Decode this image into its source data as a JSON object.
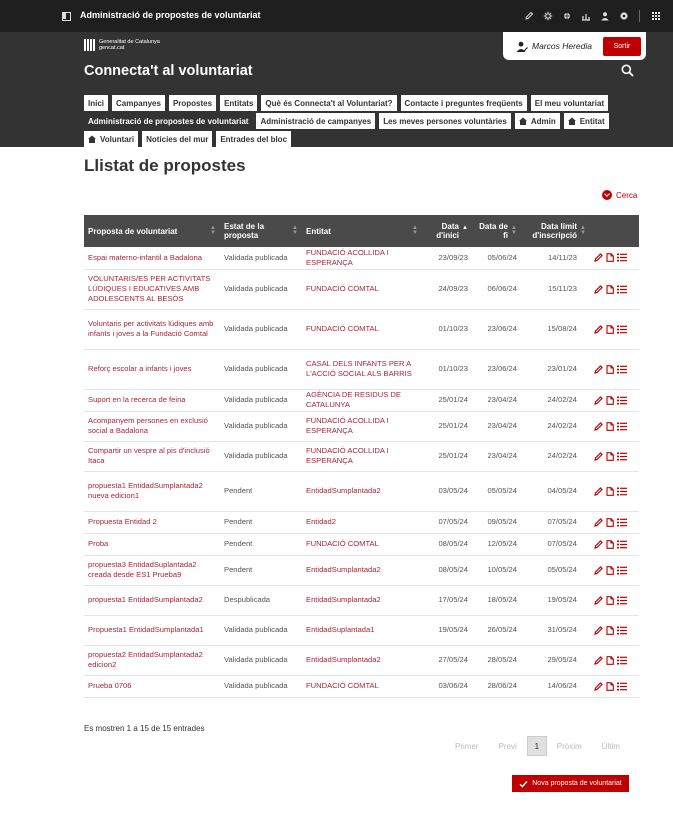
{
  "adminbar": {
    "title": "Administració de propostes de voluntariat",
    "tools": [
      "pencil-icon",
      "gear-icon",
      "palette-icon",
      "sitemap-icon",
      "user-icon",
      "settings-icon",
      "apps-grid-icon"
    ]
  },
  "header": {
    "logo_line1": "Generalitat de Catalunya",
    "logo_line2": "gencat.cat",
    "site_title": "Connecta't al voluntariat",
    "user_name": "Marcos Heredia",
    "logout_label": "Sortir"
  },
  "nav": {
    "row1": [
      "Inici",
      "Campanyes",
      "Propostes",
      "Entitats",
      "Què és Connecta't al Voluntariat?",
      "Contacte i preguntes freqüents",
      "El meu voluntariat"
    ],
    "row2": [
      "Administració de propostes de voluntariat",
      "Administració de campanyes",
      "Les meves persones voluntàries",
      "Admin",
      "Entitat"
    ],
    "row3": [
      "Voluntari",
      "Notícies del mur",
      "Entrades del bloc"
    ]
  },
  "main": {
    "page_title": "Llistat de propostes",
    "search_toggle": "Cerca",
    "columns": [
      "Proposta de voluntariat",
      "Estat de la proposta",
      "Entitat",
      "Data d'inici",
      "Data de fi",
      "Data límit d'inscripció"
    ],
    "rows": [
      {
        "proposta": "Espai materno-infantil a Badalona",
        "estat": "Validada publicada",
        "entitat": "FUNDACIÓ ACOLLIDA I ESPERANÇA",
        "inici": "23/09/23",
        "fi": "05/06/24",
        "limit": "14/11/23"
      },
      {
        "proposta": "VOLUNTARIS/ES PER ACTIVITATS LÚDIQUES I EDUCATIVES AMB ADOLESCENTS AL BESÒS",
        "estat": "Validada publicada",
        "entitat": "FUNDACIÓ COMTAL",
        "inici": "24/09/23",
        "fi": "06/06/24",
        "limit": "15/11/23"
      },
      {
        "proposta": "Voluntaris per activitats lúdiques amb infants i joves a la Fundació Comtal",
        "estat": "Validada publicada",
        "entitat": "FUNDACIÓ COMTAL",
        "inici": "01/10/23",
        "fi": "23/06/24",
        "limit": "15/08/24"
      },
      {
        "proposta": "Reforç escolar a infants i joves",
        "estat": "Validada publicada",
        "entitat": "CASAL DELS INFANTS PER A L'ACCIÓ SOCIAL ALS BARRIS",
        "inici": "01/10/23",
        "fi": "23/06/24",
        "limit": "23/01/24"
      },
      {
        "proposta": "Suport en la recerca de feina",
        "estat": "Validada publicada",
        "entitat": "AGÈNCIA DE RESIDUS DE CATALUNYA",
        "inici": "25/01/24",
        "fi": "23/04/24",
        "limit": "24/02/24"
      },
      {
        "proposta": "Acompanyem persones en exclusió social a Badalona",
        "estat": "Validada publicada",
        "entitat": "FUNDACIÓ ACOLLIDA I ESPERANÇA",
        "inici": "25/01/24",
        "fi": "23/04/24",
        "limit": "24/02/24"
      },
      {
        "proposta": "Compartir un vespre al pis d'inclusió Itaca",
        "estat": "Validada publicada",
        "entitat": "FUNDACIÓ ACOLLIDA I ESPERANÇA",
        "inici": "25/01/24",
        "fi": "23/04/24",
        "limit": "24/02/24"
      },
      {
        "proposta": "propuesta1 EntidadSumplantada2 nueva edicion1",
        "estat": "Pendent",
        "entitat": "EntidadSumplantada2",
        "inici": "03/05/24",
        "fi": "05/05/24",
        "limit": "04/05/24"
      },
      {
        "proposta": "Propuesta Entidad 2",
        "estat": "Pendent",
        "entitat": "Entidad2",
        "inici": "07/05/24",
        "fi": "09/05/24",
        "limit": "07/05/24"
      },
      {
        "proposta": "Proba",
        "estat": "Pendent",
        "entitat": "FUNDACIÓ COMTAL",
        "inici": "08/05/24",
        "fi": "12/05/24",
        "limit": "07/05/24"
      },
      {
        "proposta": "propuesta3 EntidadSuplantada2 creada desde ES1 Prueba9",
        "estat": "Pendent",
        "entitat": "EntidadSumplantada2",
        "inici": "08/05/24",
        "fi": "10/05/24",
        "limit": "05/05/24"
      },
      {
        "proposta": "propuesta1 EntidadSumplantada2",
        "estat": "Despublicada",
        "entitat": "EntidadSumplantada2",
        "inici": "17/05/24",
        "fi": "18/05/24",
        "limit": "19/05/24"
      },
      {
        "proposta": "Propuesta1 EntidadSumplantada1",
        "estat": "Validada publicada",
        "entitat": "EntidadSuplantada1",
        "inici": "19/05/24",
        "fi": "26/05/24",
        "limit": "31/05/24"
      },
      {
        "proposta": "propuesta2 EntidadSumplantada2 edicion2",
        "estat": "Validada publicada",
        "entitat": "EntidadSumplantada2",
        "inici": "27/05/24",
        "fi": "28/05/24",
        "limit": "29/05/24"
      },
      {
        "proposta": "Prueba 0706",
        "estat": "Validada publicada",
        "entitat": "FUNDACIÓ COMTAL",
        "inici": "03/06/24",
        "fi": "28/06/24",
        "limit": "14/06/24"
      }
    ],
    "info": "Es mostren 1 a 15 de 15 entrades",
    "pager": {
      "first": "Primer",
      "prev": "Previ",
      "current": "1",
      "next": "Pròxim",
      "last": "Últim"
    },
    "new_button": "Nova proposta de voluntariat"
  },
  "colors": {
    "accent": "#c00000",
    "link": "#a8273a",
    "header_bg": "#333333",
    "table_head": "#4a4a4a"
  }
}
